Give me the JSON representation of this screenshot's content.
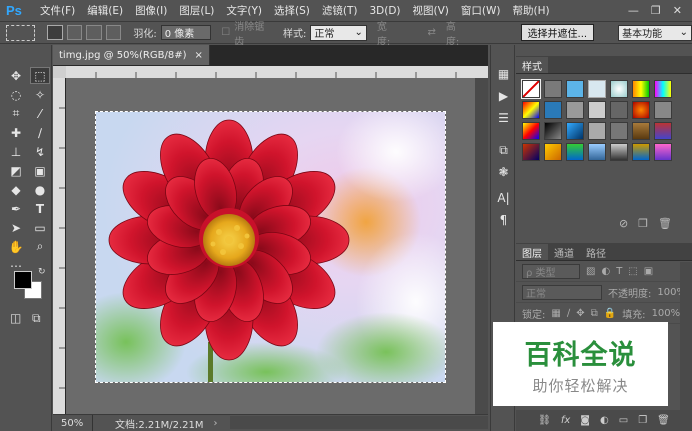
{
  "app": {
    "logo": "Ps"
  },
  "menu": [
    "文件(F)",
    "编辑(E)",
    "图像(I)",
    "图层(L)",
    "文字(Y)",
    "选择(S)",
    "滤镜(T)",
    "3D(D)",
    "视图(V)",
    "窗口(W)",
    "帮助(H)"
  ],
  "window_controls": {
    "minimize": "—",
    "restore": "❐",
    "close": "✕"
  },
  "options": {
    "feather_label": "羽化:",
    "feather_value": "0 像素",
    "antialias_label": "消除锯齿",
    "style_label": "样式:",
    "style_value": "正常",
    "width_label": "宽度:",
    "height_label": "高度:",
    "select_mask_button": "选择并遮住...",
    "workspace_value": "基本功能"
  },
  "document": {
    "tab_title": "timg.jpg @ 50%(RGB/8#)",
    "tab_close": "×",
    "zoom": "50%",
    "doc_info": "文档:2.21M/2.21M"
  },
  "styles_panel": {
    "tab": "样式"
  },
  "layers_panel": {
    "tabs": [
      "图层",
      "通道",
      "路径"
    ],
    "filter_label": "ρ 类型",
    "blend_mode": "正常",
    "opacity_label": "不透明度:",
    "opacity_value": "100%",
    "lock_label": "锁定:",
    "fill_label": "填充:",
    "fill_value": "100%"
  },
  "watermark": {
    "main": "百科全说",
    "sub": "助你轻松解决"
  },
  "colors": {
    "foreground": "#000000",
    "background": "#ffffff",
    "accent": "#31a8ff",
    "watermark_green": "#2a8f3c"
  }
}
